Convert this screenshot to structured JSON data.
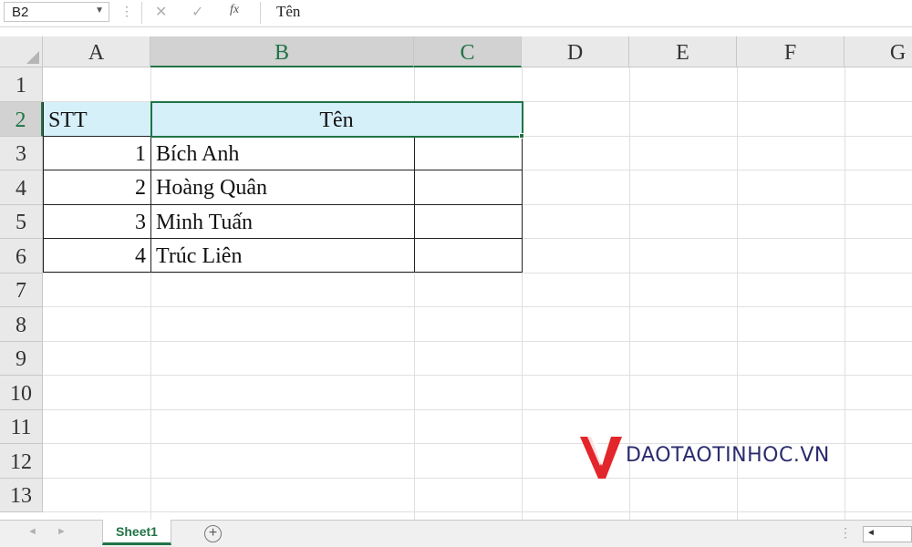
{
  "formula_bar": {
    "name_box": "B2",
    "name_box_arrow": "▼",
    "dots": "⋮",
    "cancel_icon": "✕",
    "enter_icon": "✓",
    "fx": "fx",
    "formula": "Tên"
  },
  "grid": {
    "columns": [
      "A",
      "B",
      "C",
      "D",
      "E",
      "F",
      "G"
    ],
    "rows": [
      "1",
      "2",
      "3",
      "4",
      "5",
      "6",
      "7",
      "8",
      "9",
      "10",
      "11",
      "12",
      "13"
    ],
    "selected_column": "B",
    "selected_row": "2",
    "table": {
      "header": {
        "stt": "STT",
        "ten": "Tên"
      },
      "rows": [
        {
          "stt": "1",
          "ten": "Bích Anh"
        },
        {
          "stt": "2",
          "ten": "Hoàng Quân"
        },
        {
          "stt": "3",
          "ten": "Minh Tuấn"
        },
        {
          "stt": "4",
          "ten": "Trúc Liên"
        }
      ]
    },
    "header_fill_color": "#d6f0fa",
    "selection_color": "#217346"
  },
  "watermark": {
    "text": "DAOTAOTINHOC.VN",
    "colors": {
      "red": "#e3262b",
      "navy": "#2b2b6e"
    }
  },
  "sheet_tabs": {
    "prev_icon": "◄",
    "next_icon": "►",
    "active_tab": "Sheet1",
    "add_icon": "+",
    "dots": "⋮",
    "scroll_arrow": "◄"
  }
}
